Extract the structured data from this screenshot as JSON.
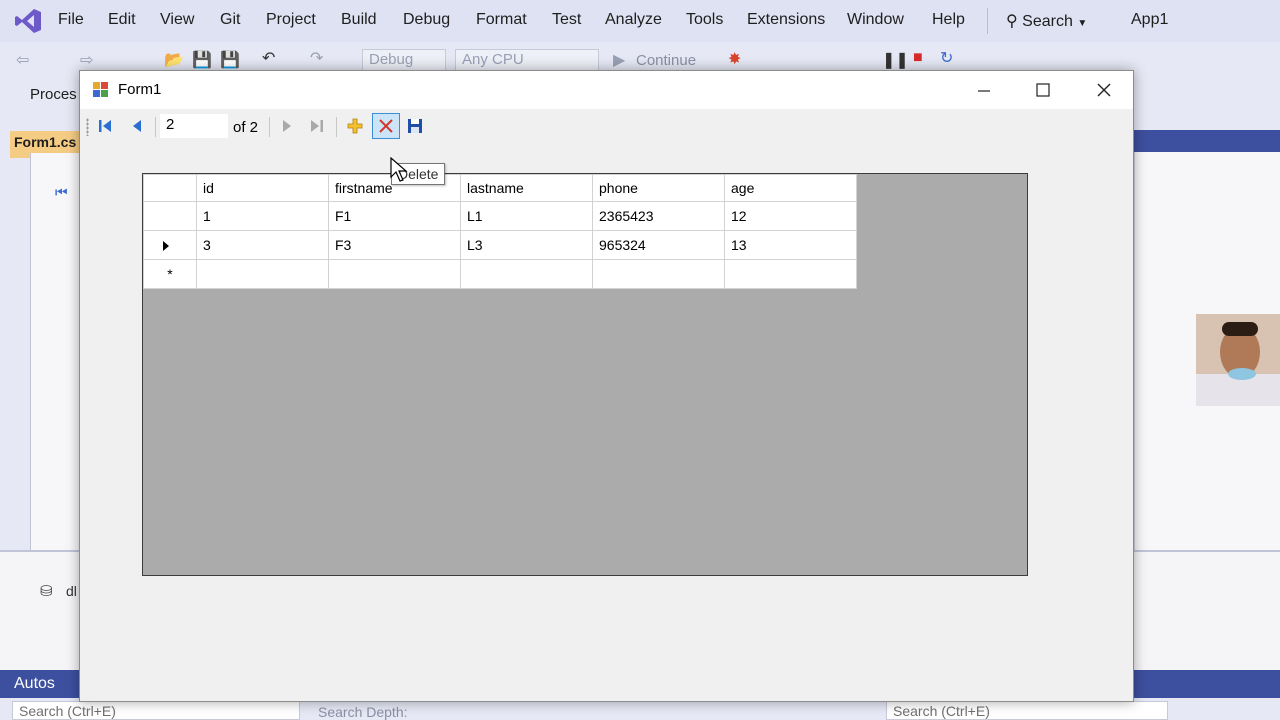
{
  "vs": {
    "menu": [
      "File",
      "Edit",
      "View",
      "Git",
      "Project",
      "Build",
      "Debug",
      "Format",
      "Test",
      "Analyze",
      "Tools",
      "Extensions",
      "Window",
      "Help"
    ],
    "search_label": "Search",
    "solution_name": "App1",
    "config_combo": "Debug",
    "platform_combo": "Any CPU",
    "continue_label": "Continue",
    "toolbar2_label": "Proces",
    "doc_tab_label": "Form1.cs",
    "bottom_pane_label": "dl",
    "autos_label": "Autos",
    "search_box_left": "Search (Ctrl+E)",
    "search_depth_label": "Search Depth:",
    "search_box_right": "Search (Ctrl+E)",
    "accent_color": "#3d4f9f"
  },
  "form": {
    "title": "Form1",
    "window_buttons": [
      "minimize",
      "maximize",
      "close"
    ],
    "navigator": {
      "position": "2",
      "count_label": "of 2",
      "buttons": [
        "move-first-icon",
        "move-previous-icon",
        "move-next-icon",
        "move-last-icon",
        "add-new-icon",
        "delete-icon",
        "save-icon"
      ]
    },
    "tooltip": "Delete",
    "grid": {
      "columns": [
        "id",
        "firstname",
        "lastname",
        "phone",
        "age"
      ],
      "rows": [
        [
          "1",
          "F1",
          "L1",
          "2365423",
          "12"
        ],
        [
          "3",
          "F3",
          "L3",
          "965324",
          "13"
        ]
      ],
      "current_row_index": 1,
      "new_row_marker": "*"
    }
  }
}
